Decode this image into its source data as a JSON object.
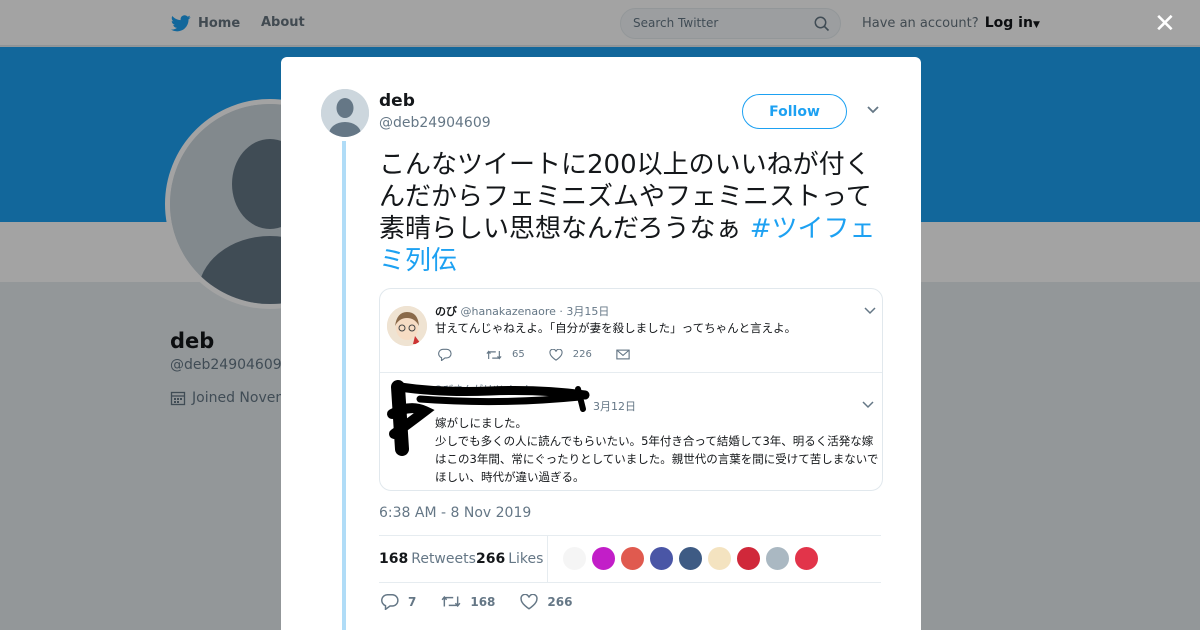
{
  "nav": {
    "home_label": "Home",
    "about_label": "About",
    "search_placeholder": "Search Twitter",
    "account_prompt": "Have an account?",
    "login_label": "Log in"
  },
  "profile": {
    "name": "deb",
    "handle": "@deb24904609",
    "joined": "Joined Novem"
  },
  "tweet": {
    "name": "deb",
    "handle": "@deb24904609",
    "follow_label": "Follow",
    "text": "こんなツイートに200以上のいいねが付くんだからフェミニズムやフェミニストって素晴らしい思想なんだろうなぁ",
    "hashtag": "#ツイフェミ列伝",
    "timestamp": "6:38 AM - 8 Nov 2019",
    "retweets_count": "168",
    "retweets_label": "Retweets",
    "likes_count": "266",
    "likes_label": "Likes",
    "replies": "7",
    "retweets": "168",
    "likes": "266"
  },
  "embed": {
    "tweet1": {
      "name": "のび",
      "handle": "@hanakazenaore",
      "date": "· 3月15日",
      "text": "甘えてんじゃねえよ。「自分が妻を殺しました」ってちゃんと言えよ。",
      "retweets": "65",
      "likes": "226"
    },
    "tweet2": {
      "retweet_label": "のびさんがリツイート",
      "date": "3月12日",
      "text": "嫁がしにました。\n少しでも多くの人に読んでもらいたい。5年付き合って結婚して3年、明るく活発な嫁はこの3年間、常にぐったりとしていました。親世代の言葉を間に受けて苦しまないでほしい、時代が違い過ぎる。"
    }
  },
  "likers_colors": [
    "#f5f5f5",
    "#c21ec8",
    "#e05a4f",
    "#4a56a6",
    "#3e5b84",
    "#f4e3c0",
    "#d0283a",
    "#aab8c2",
    "#e2344a"
  ],
  "colors": {
    "accent": "#1da1f2",
    "banner": "#1da1f2",
    "thread_line": "#b0dcf7"
  }
}
